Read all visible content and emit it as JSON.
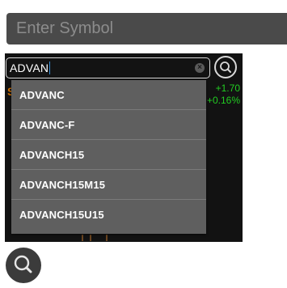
{
  "top_field": {
    "placeholder": "Enter Symbol"
  },
  "search": {
    "value": "ADVAN"
  },
  "quote": {
    "side_letter": "S",
    "change": "+1.70",
    "change_pct": "+0.16%"
  },
  "suggestions": [
    {
      "label": "ADVANC"
    },
    {
      "label": "ADVANC-F"
    },
    {
      "label": "ADVANCH15"
    },
    {
      "label": "ADVANCH15M15"
    },
    {
      "label": "ADVANCH15U15"
    }
  ],
  "colors": {
    "positive": "#22cc22",
    "accent_orange": "#d07000",
    "dropdown_bg": "#5f5f5f",
    "panel_bg": "#121212"
  },
  "icons": {
    "clear": "clear-circle-icon",
    "search_small": "search-icon",
    "search_large": "search-icon"
  }
}
